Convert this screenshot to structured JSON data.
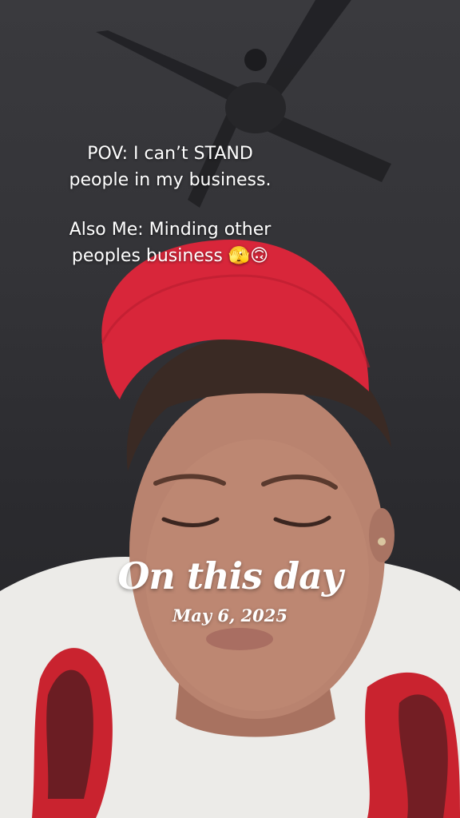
{
  "caption": {
    "line1": "POV: I can’t STAND",
    "line2": "people in my business.",
    "line3": "Also Me: Minding other",
    "line4": "peoples business 🫣🙃"
  },
  "memory": {
    "title": "On this day",
    "date": "May 6, 2025"
  },
  "colors": {
    "cap": "#d8263a",
    "shirt": "#ececea",
    "skin": "#b9836f",
    "hair": "#3a2a24",
    "wall": "#333337"
  },
  "icons": {
    "fan": "ceiling-fan-icon"
  }
}
